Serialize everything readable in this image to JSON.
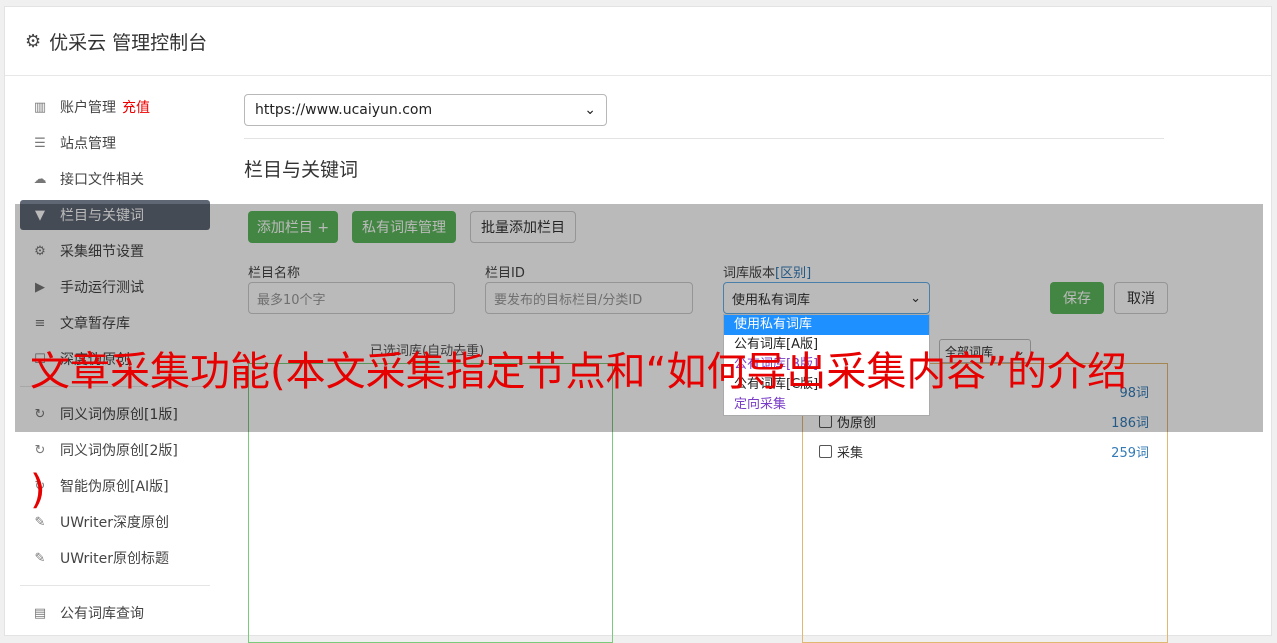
{
  "header": {
    "title": "优采云 管理控制台",
    "icon": "gear-icon"
  },
  "sidebar": {
    "items": [
      {
        "label": "账户管理",
        "icon": "bar-chart-icon",
        "badge": "充值"
      },
      {
        "label": "站点管理",
        "icon": "server-icon"
      },
      {
        "label": "接口文件相关",
        "icon": "cloud-upload-icon"
      },
      {
        "label": "栏目与关键词",
        "icon": "filter-icon",
        "active": true
      },
      {
        "label": "采集细节设置",
        "icon": "cogs-icon"
      },
      {
        "label": "手动运行测试",
        "icon": "play-circle-icon"
      },
      {
        "label": "文章暂存库",
        "icon": "database-icon"
      },
      {
        "label": "深度伪原创",
        "icon": "square-icon"
      },
      {
        "label": "同义词伪原创[1版]",
        "icon": "refresh-icon"
      },
      {
        "label": "同义词伪原创[2版]",
        "icon": "refresh-icon"
      },
      {
        "label": "智能伪原创[AI版]",
        "icon": "refresh-icon"
      },
      {
        "label": "UWriter深度原创",
        "icon": "edit-icon"
      },
      {
        "label": "UWriter原创标题",
        "icon": "edit-icon"
      },
      {
        "label": "公有词库查询",
        "icon": "book-icon"
      }
    ]
  },
  "main": {
    "site_select_value": "https://www.ucaiyun.com",
    "section_title": "栏目与关键词",
    "buttons": {
      "add_column": "添加栏目 +",
      "private_lib": "私有词库管理",
      "batch_add": "批量添加栏目",
      "save": "保存",
      "cancel": "取消"
    },
    "form": {
      "column_name_label": "栏目名称",
      "column_name_placeholder": "最多10个字",
      "column_id_label": "栏目ID",
      "column_id_placeholder": "要发布的目标栏目/分类ID",
      "lib_version_label": "词库版本",
      "lib_version_link": "[区别]",
      "lib_version_value": "使用私有词库",
      "lib_version_options": [
        "使用私有词库",
        "公有词库[A版]",
        "公有词库[B版]",
        "公有词库[C版]",
        "定向采集"
      ]
    },
    "selected_lib_title": "已选词库(自动去重)",
    "all_lib_select": "全部词库",
    "libraries": [
      {
        "name": "",
        "count": "98词"
      },
      {
        "name": "伪原创",
        "count": "186词"
      },
      {
        "name": "采集",
        "count": "259词"
      }
    ]
  },
  "banner": {
    "line1": "文章采集功能(本文采集指定节点和“如何导出采集内容”的介绍",
    "line2": ")"
  }
}
